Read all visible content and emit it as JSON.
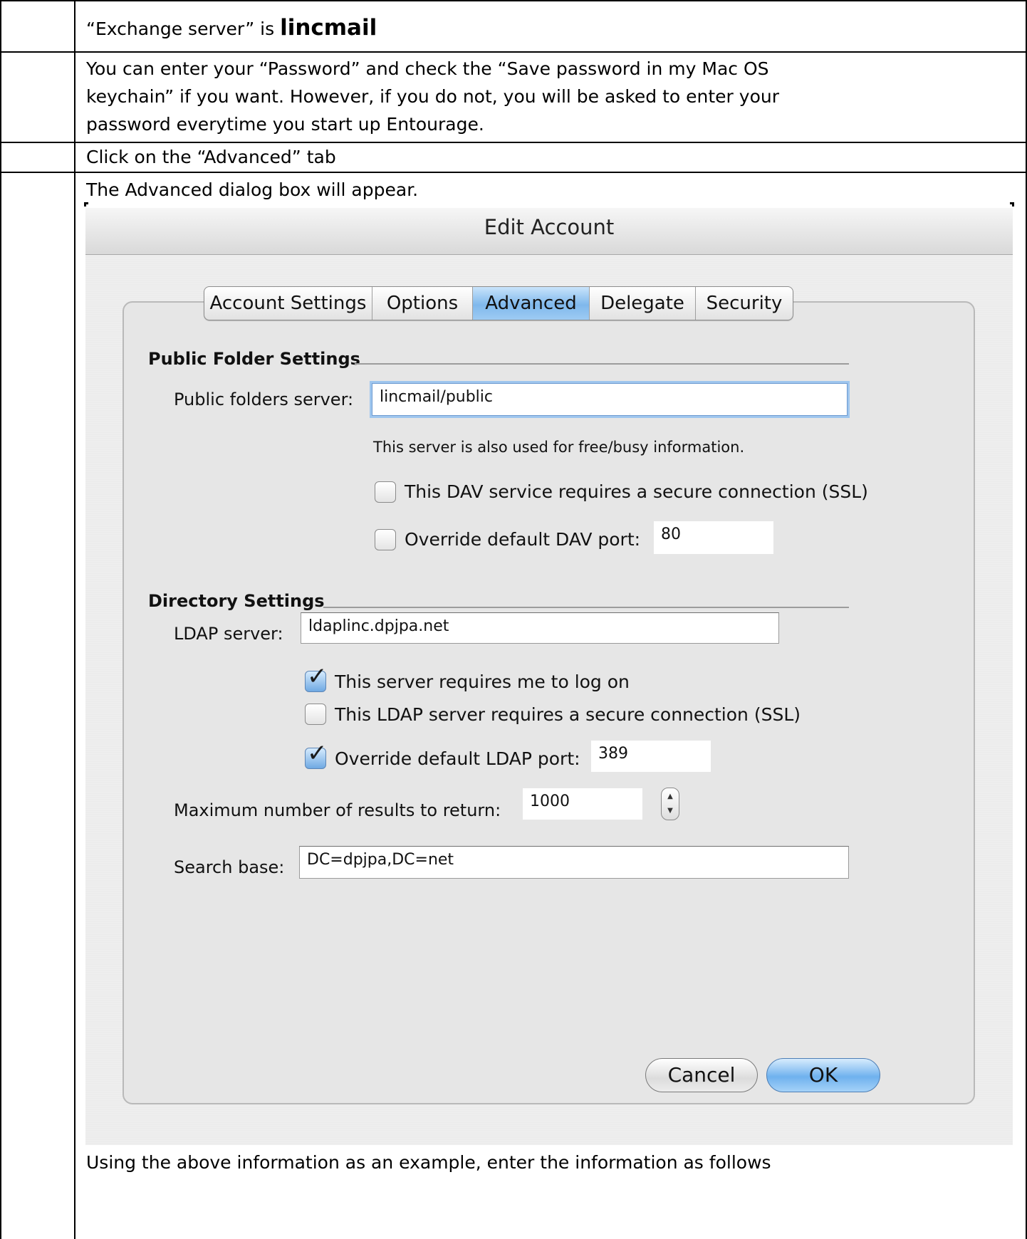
{
  "document": {
    "row1_text": "“Exchange server” is ",
    "row1_bold": "lincmail",
    "row2_lines": [
      "You can enter your “Password” and check the “Save password in my Mac OS",
      "keychain” if you want.  However, if you do not, you will be asked to enter your",
      "password everytime you start up Entourage."
    ],
    "row3_text": "Click on the “Advanced” tab",
    "row4_intro": "The Advanced dialog box will appear.",
    "footer_text": "Using the above information as an example, enter the information as follows"
  },
  "dialog": {
    "title": "Edit Account",
    "tabs": [
      "Account Settings",
      "Options",
      "Advanced",
      "Delegate",
      "Security"
    ],
    "active_tab": "Advanced",
    "public_folder": {
      "section_title": "Public Folder Settings",
      "server_label": "Public folders server:",
      "server_value": "lincmail/public",
      "note": "This server is also used for free/busy information.",
      "ssl_label": "This DAV service requires a secure connection (SSL)",
      "ssl_checked": false,
      "port_label": "Override default DAV port:",
      "port_checked": false,
      "port_value": "80"
    },
    "directory": {
      "section_title": "Directory Settings",
      "ldap_label": "LDAP server:",
      "ldap_value": "ldaplinc.dpjpa.net",
      "logon_label": "This server requires me to log on",
      "logon_checked": true,
      "ssl_label": "This LDAP server requires a secure connection (SSL)",
      "ssl_checked": false,
      "port_label": "Override default LDAP port:",
      "port_checked": true,
      "port_value": "389",
      "max_results_label": "Maximum number of results to return:",
      "max_results_value": "1000",
      "search_base_label": "Search base:",
      "search_base_value": "DC=dpjpa,DC=net"
    },
    "buttons": {
      "cancel": "Cancel",
      "ok": "OK"
    }
  },
  "icons": {
    "checkmark": "checkmark-icon",
    "stepper_up": "arrow-up-icon",
    "stepper_down": "arrow-down-icon"
  }
}
